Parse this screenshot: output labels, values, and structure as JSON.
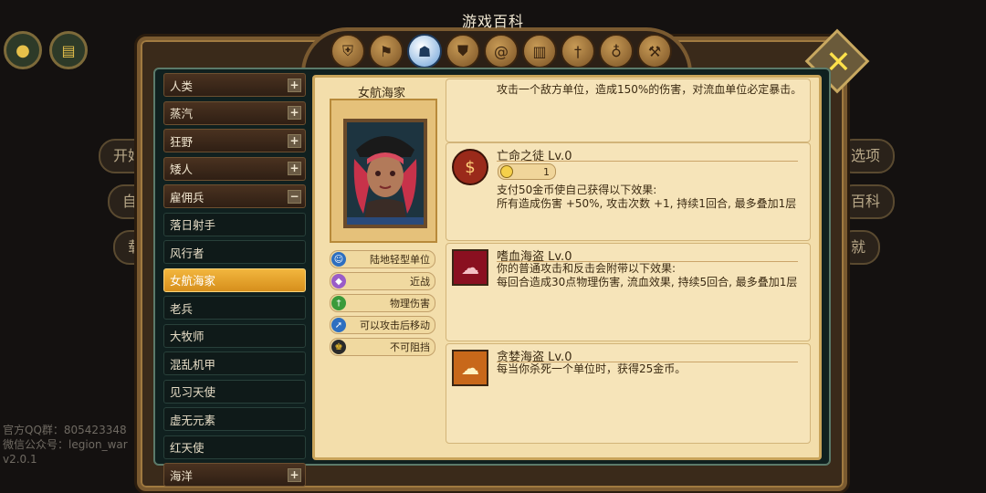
{
  "title": "游戏百科",
  "background": {
    "buttons_left": [
      "开始",
      "自",
      "载"
    ],
    "buttons_right": [
      "选项",
      "百科",
      "就"
    ],
    "info_lines": [
      "官方QQ群：805423348",
      "微信公众号：legion_war",
      "v2.0.1"
    ]
  },
  "sidebar": {
    "items": [
      {
        "label": "人类",
        "kind": "cat",
        "toggle": "+"
      },
      {
        "label": "蒸汽",
        "kind": "cat",
        "toggle": "+"
      },
      {
        "label": "狂野",
        "kind": "cat",
        "toggle": "+"
      },
      {
        "label": "矮人",
        "kind": "cat",
        "toggle": "+"
      },
      {
        "label": "雇佣兵",
        "kind": "cat",
        "toggle": "−"
      },
      {
        "label": "落日射手",
        "kind": "sub"
      },
      {
        "label": "风行者",
        "kind": "sub"
      },
      {
        "label": "女航海家",
        "kind": "active"
      },
      {
        "label": "老兵",
        "kind": "sub"
      },
      {
        "label": "大牧师",
        "kind": "sub"
      },
      {
        "label": "混乱机甲",
        "kind": "sub"
      },
      {
        "label": "见习天使",
        "kind": "sub"
      },
      {
        "label": "虚无元素",
        "kind": "sub"
      },
      {
        "label": "红天使",
        "kind": "sub"
      },
      {
        "label": "海洋",
        "kind": "cat",
        "toggle": "+"
      }
    ]
  },
  "hero": {
    "name": "女航海家",
    "traits": [
      {
        "label": "陆地轻型单位",
        "icon": "person-icon",
        "color": "#2e6fc0"
      },
      {
        "label": "近战",
        "icon": "diamond-icon",
        "color": "#9a5cc8"
      },
      {
        "label": "物理伤害",
        "icon": "sword-icon",
        "color": "#3a9a3a"
      },
      {
        "label": "可以攻击后移动",
        "icon": "move-icon",
        "color": "#2e6fc0"
      },
      {
        "label": "不可阻挡",
        "icon": "unstoppable-icon",
        "color": "#c89a2a"
      }
    ]
  },
  "skills": [
    {
      "title": "",
      "desc": [
        "攻击一个敌方单位，造成150%的伤害，对流血单位必定暴击。"
      ],
      "icon": "",
      "cost": null
    },
    {
      "title": "亡命之徒 Lv.0",
      "desc": [
        "支付50金币使自己获得以下效果:",
        "所有造成伤害 +50%, 攻击次数 +1, 持续1回合, 最多叠加1层"
      ],
      "icon": "coin-icon",
      "cost": "1"
    },
    {
      "title": "嗜血海盗 Lv.0",
      "desc": [
        "你的普通攻击和反击会附带以下效果:",
        "每回合造成30点物理伤害, 流血效果, 持续5回合, 最多叠加1层"
      ],
      "icon": "blood-icon",
      "cost": null
    },
    {
      "title": "贪婪海盗 Lv.0",
      "desc": [
        "每当你杀死一个单位时，获得25金币。"
      ],
      "icon": "greed-icon",
      "cost": null
    }
  ]
}
